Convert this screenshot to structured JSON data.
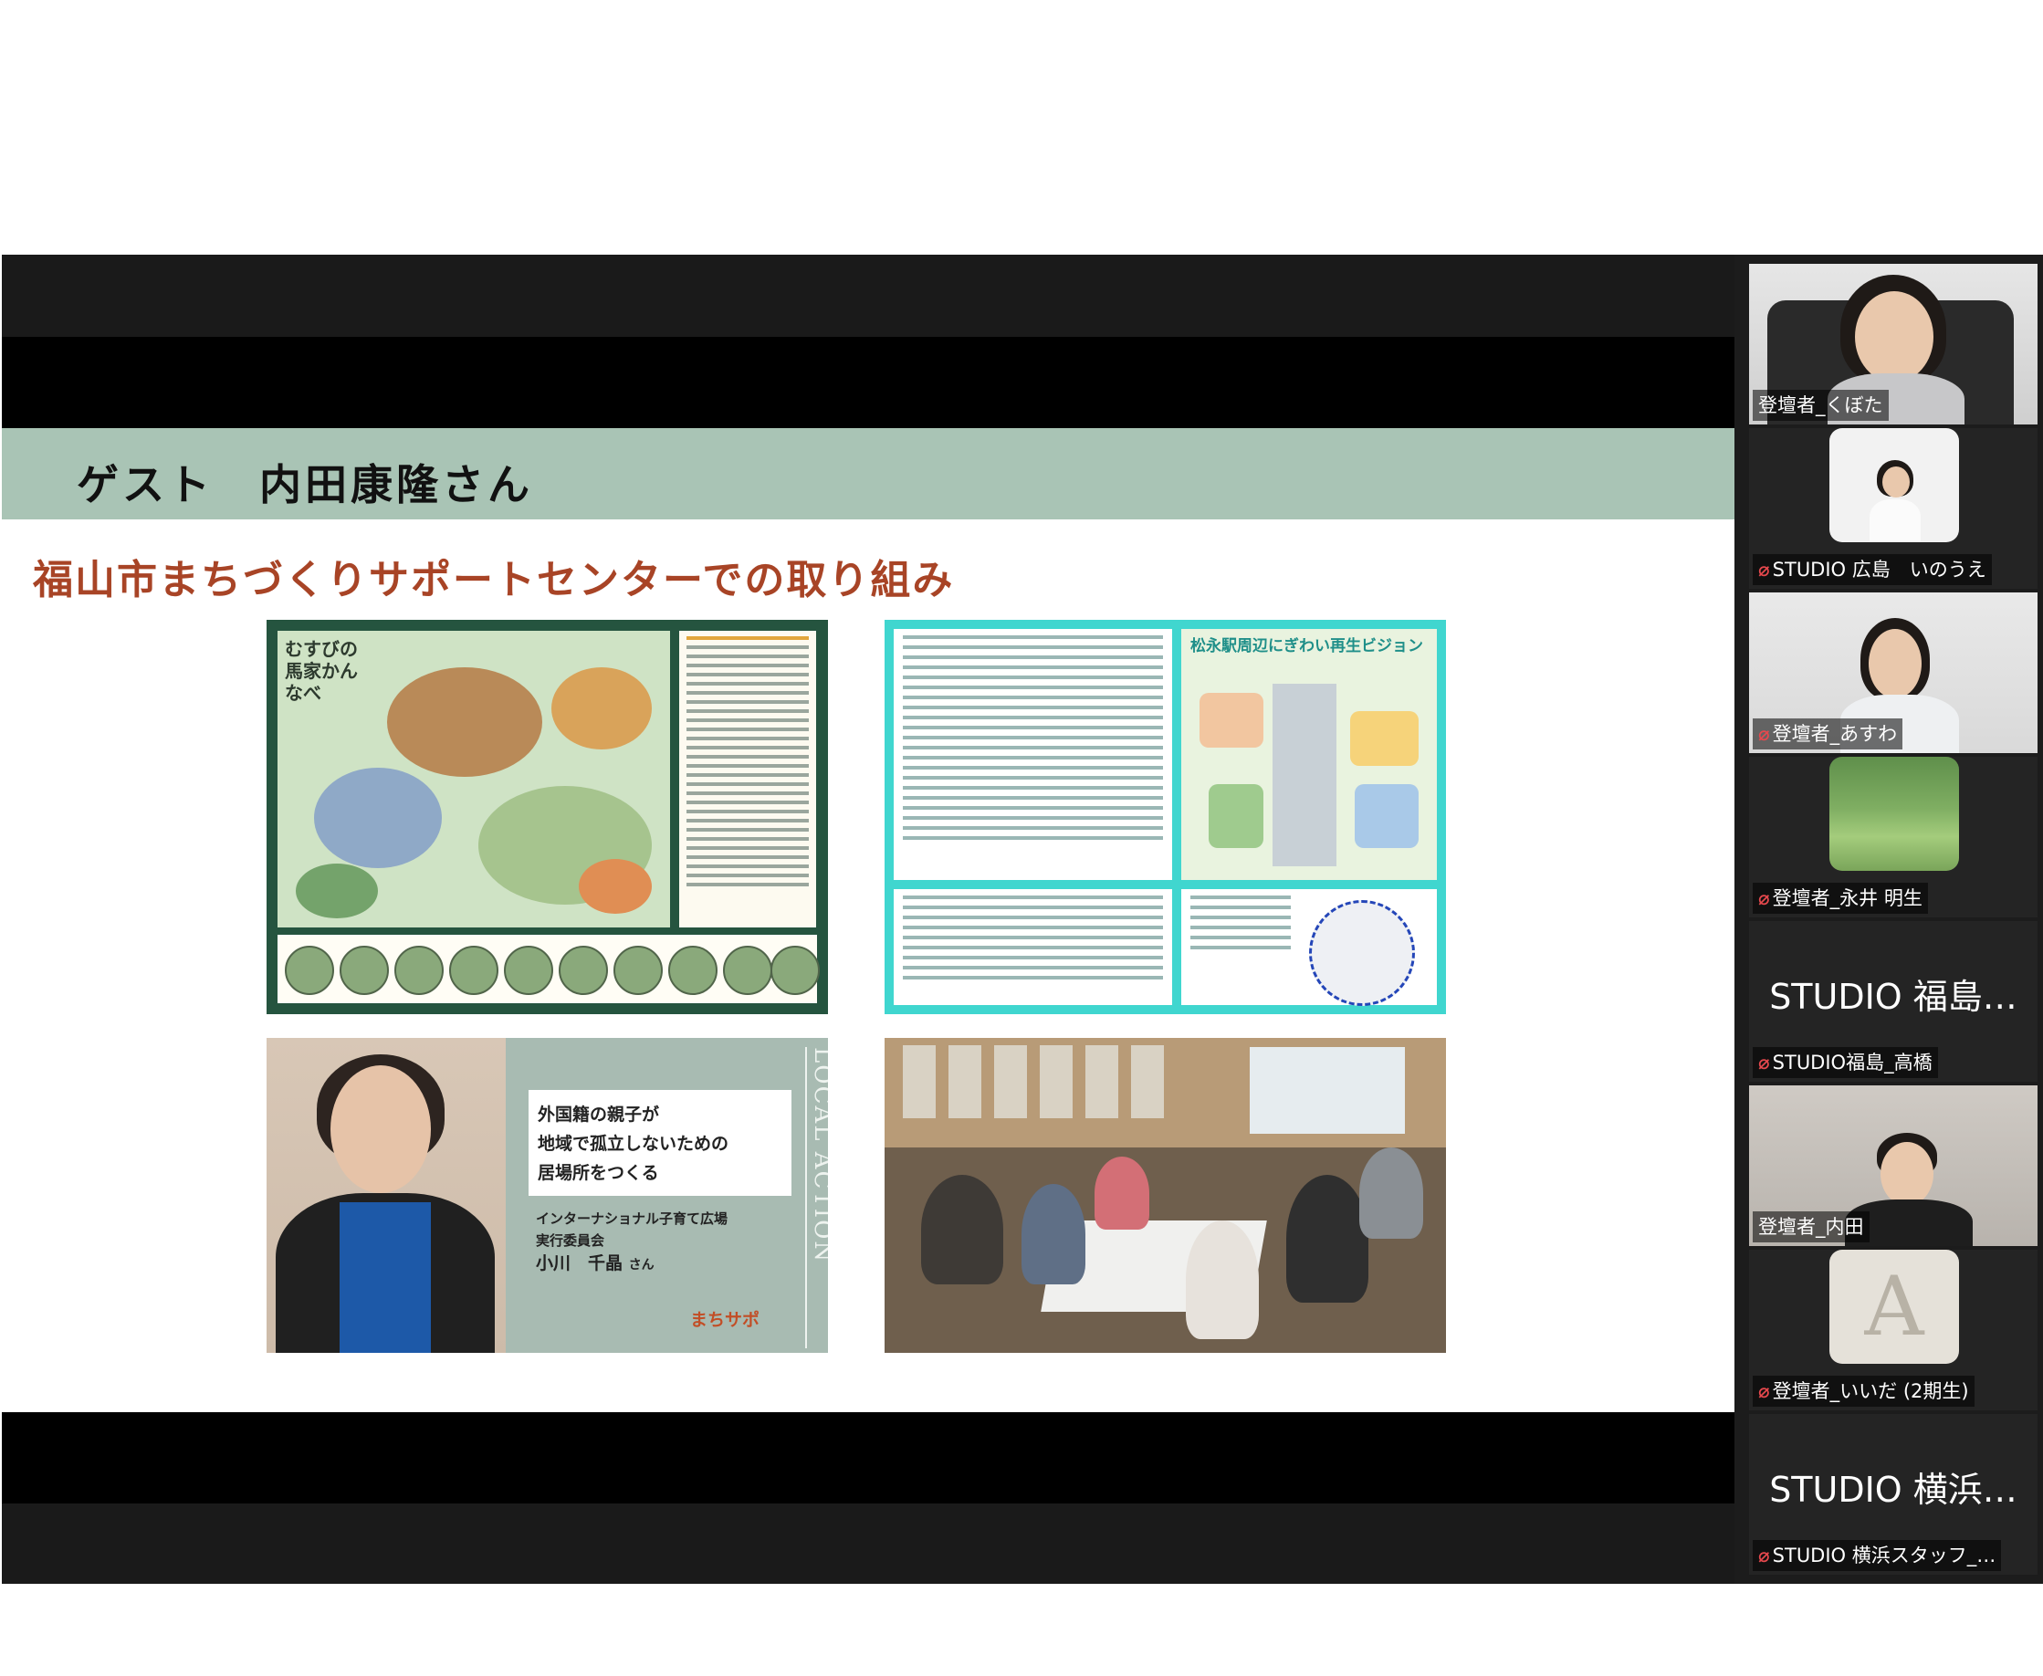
{
  "slide": {
    "header": "ゲスト　内田康隆さん",
    "subtitle": "福山市まちづくりサポートセンターでの取り組み",
    "panel_map": {
      "title": "むすびの馬家かんなべ"
    },
    "panel_vision": {
      "title": "松永駅周辺にぎわい再生ビジョン"
    },
    "panel_profile": {
      "card_lines": [
        "外国籍の親子が",
        "地域で孤立しないための",
        "居場所をつくる"
      ],
      "organization": "インターナショナル子育て広場\n実行委員会",
      "person_name": "小川　千晶",
      "honorific": "さん",
      "vertical_text": "LOCAL ACTION",
      "logo": "まちサポ"
    }
  },
  "participants": [
    {
      "name": "登壇者_くぼた",
      "muted": false,
      "video": true,
      "active": false
    },
    {
      "name": "STUDIO 広島　いのうえ",
      "muted": true,
      "video": true,
      "active": false
    },
    {
      "name": "登壇者_あすわ",
      "muted": true,
      "video": true,
      "active": false
    },
    {
      "name": "登壇者_永井 明生",
      "muted": true,
      "video": true,
      "active": false
    },
    {
      "name": "STUDIO福島_高橋",
      "display_name": "STUDIO 福島…",
      "muted": true,
      "video": false,
      "active": false
    },
    {
      "name": "登壇者_内田",
      "muted": false,
      "video": true,
      "active": true
    },
    {
      "name": "登壇者_いいだ (2期生)",
      "muted": true,
      "video": true,
      "active": false
    },
    {
      "name": "STUDIO 横浜スタッフ_…",
      "display_name": "STUDIO 横浜…",
      "muted": true,
      "video": false,
      "active": false
    }
  ],
  "icons": {
    "mute": "microphone-muted-icon"
  },
  "colors": {
    "header_bg": "#a9c4b5",
    "subtitle": "#a84426",
    "active_speaker": "#23d160",
    "muted": "#e5484d"
  }
}
